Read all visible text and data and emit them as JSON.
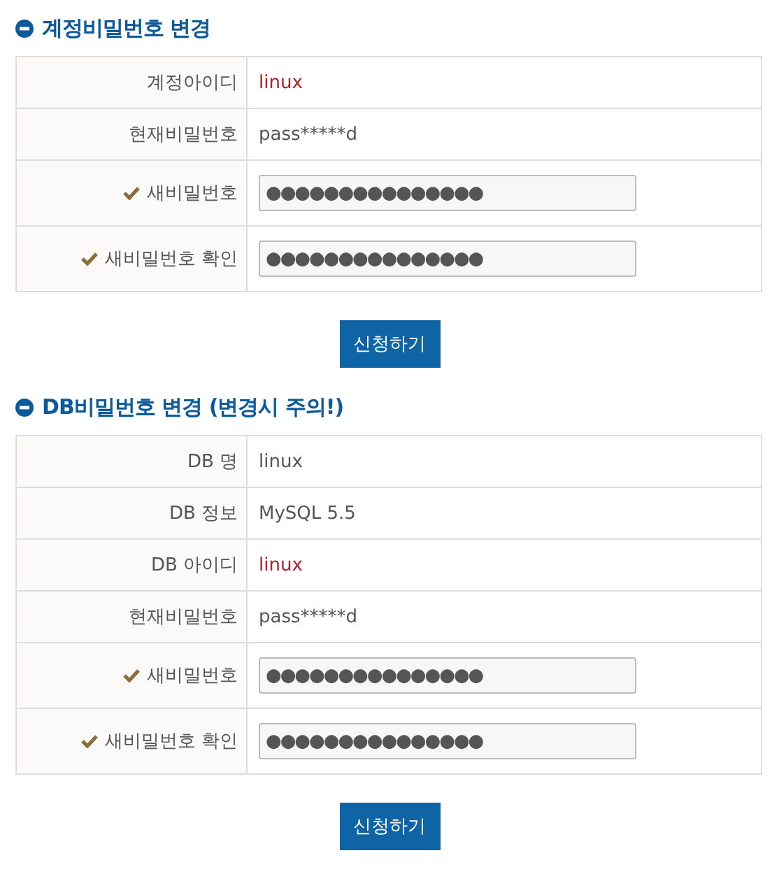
{
  "sections": [
    {
      "title": "계정비밀번호 변경",
      "rows": [
        {
          "kind": "text",
          "label": "계정아이디",
          "value": "linux",
          "emphasis": true
        },
        {
          "kind": "text",
          "label": "현재비밀번호",
          "value": "pass*****d",
          "emphasis": false
        },
        {
          "kind": "password",
          "label": "새비밀번호",
          "value": "●●●●●●●●●●●●●●●",
          "required": true
        },
        {
          "kind": "password",
          "label": "새비밀번호 확인",
          "value": "●●●●●●●●●●●●●●●",
          "required": true
        }
      ],
      "button": "신청하기"
    },
    {
      "title": "DB비밀번호 변경 (변경시 주의!)",
      "rows": [
        {
          "kind": "text",
          "label": "DB 명",
          "value": "linux",
          "emphasis": false
        },
        {
          "kind": "text",
          "label": "DB 정보",
          "value": "MySQL 5.5",
          "emphasis": false
        },
        {
          "kind": "text",
          "label": "DB 아이디",
          "value": "linux",
          "emphasis": true
        },
        {
          "kind": "text",
          "label": "현재비밀번호",
          "value": "pass*****d",
          "emphasis": false
        },
        {
          "kind": "password",
          "label": "새비밀번호",
          "value": "●●●●●●●●●●●●●●●",
          "required": true
        },
        {
          "kind": "password",
          "label": "새비밀번호 확인",
          "value": "●●●●●●●●●●●●●●●",
          "required": true
        }
      ],
      "button": "신청하기"
    }
  ]
}
